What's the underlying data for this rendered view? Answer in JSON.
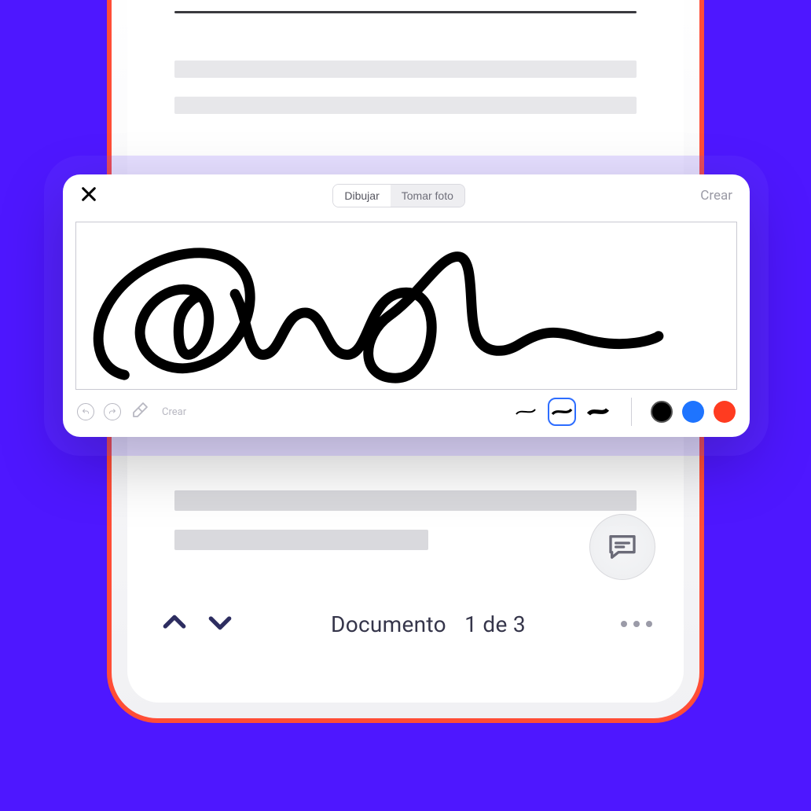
{
  "signature_panel": {
    "tabs": {
      "draw": "Dibujar",
      "photo": "Tomar foto",
      "active": "draw"
    },
    "create": "Crear",
    "footer_create": "Crear",
    "stroke_colors": {
      "black": "#000000",
      "blue": "#1e74ff",
      "red": "#ff3b20"
    },
    "selected_color": "black",
    "selected_thickness": 2
  },
  "document_nav": {
    "label": "Documento",
    "position": "1 de 3"
  }
}
